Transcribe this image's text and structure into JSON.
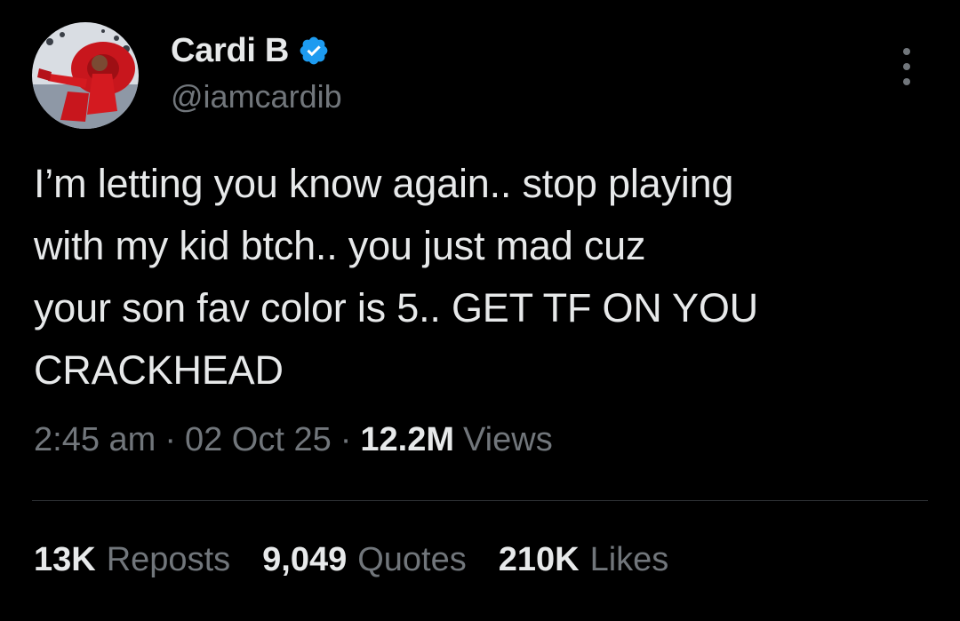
{
  "author": {
    "display_name": "Cardi B",
    "handle": "@iamcardib",
    "verified_badge_color": "#1d9bf0"
  },
  "tweet": {
    "text": "I’m letting you know again.. stop playing\nwith my kid btch.. you just mad cuz\nyour son fav color is 5.. GET TF ON YOU\nCRACKHEAD"
  },
  "meta": {
    "time": "2:45 am",
    "separator": "·",
    "date": "02 Oct 25",
    "views_count": "12.2M",
    "views_label": "Views"
  },
  "stats": {
    "reposts_count": "13K",
    "reposts_label": "Reposts",
    "quotes_count": "9,049",
    "quotes_label": "Quotes",
    "likes_count": "210K",
    "likes_label": "Likes"
  },
  "icons": {
    "verified": "verified-badge-icon",
    "more": "more-options-icon"
  },
  "colors": {
    "background": "#000000",
    "primary_text": "#e7e9ea",
    "secondary_text": "#71767b",
    "divider": "#2f3336"
  }
}
